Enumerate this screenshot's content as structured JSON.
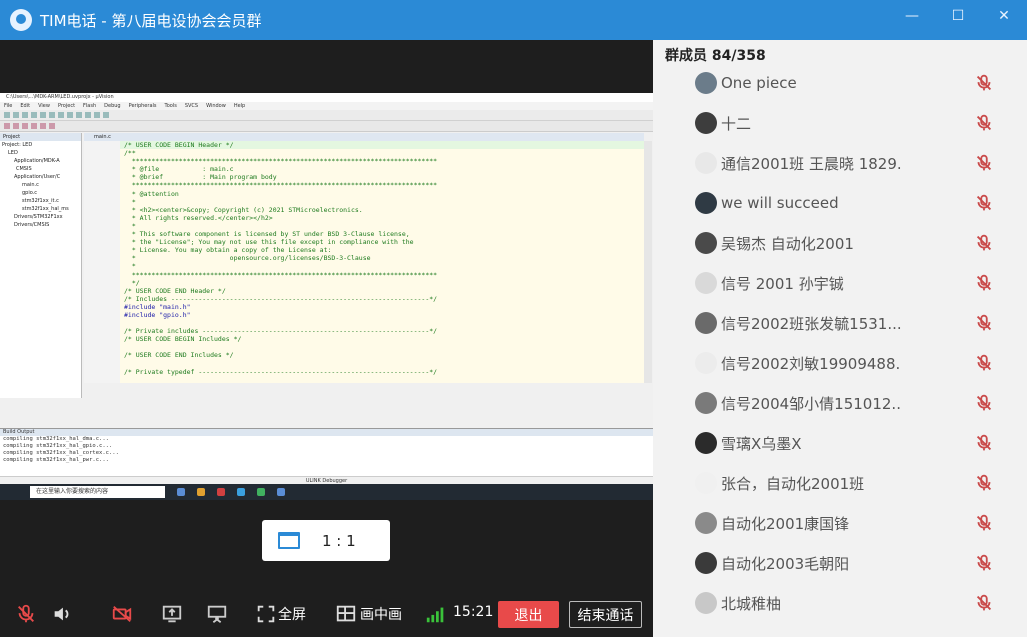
{
  "window": {
    "title": "TIM电话 - 第八届电设协会会员群",
    "controls": [
      "—",
      "☐",
      "✕"
    ]
  },
  "shared_screen": {
    "ide_title": "C:\\Users\\...\\MDK-ARM\\LED.uvprojx - µVision",
    "ide_menu": [
      "File",
      "Edit",
      "View",
      "Project",
      "Flash",
      "Debug",
      "Peripherals",
      "Tools",
      "SVCS",
      "Window",
      "Help"
    ],
    "project_header": "Project",
    "project_tree": [
      "Project: LED",
      "LED",
      "Application/MDK-A",
      "CMSIS",
      "Application/User/C",
      "main.c",
      "gpio.c",
      "stm32f1xx_it.c",
      "stm32f1xx_hal_ms",
      "Drivers/STM32F1xx",
      "Drivers/CMSIS"
    ],
    "editor_tab": "main.c",
    "code_lines": [
      "/* USER CODE BEGIN Header */",
      "/**",
      "  ******************************************************************************",
      "  * @file           : main.c",
      "  * @brief          : Main program body",
      "  ******************************************************************************",
      "  * @attention",
      "  *",
      "  * <h2><center>&copy; Copyright (c) 2021 STMicroelectronics.",
      "  * All rights reserved.</center></h2>",
      "  *",
      "  * This software component is licensed by ST under BSD 3-Clause license,",
      "  * the \"License\"; You may not use this file except in compliance with the",
      "  * License. You may obtain a copy of the License at:",
      "  *                        opensource.org/licenses/BSD-3-Clause",
      "  *",
      "  ******************************************************************************",
      "  */",
      "/* USER CODE END Header */",
      "/* Includes ------------------------------------------------------------------*/",
      "#include \"main.h\"",
      "#include \"gpio.h\"",
      "",
      "/* Private includes ----------------------------------------------------------*/",
      "/* USER CODE BEGIN Includes */",
      "",
      "/* USER CODE END Includes */",
      "",
      "/* Private typedef -----------------------------------------------------------*/"
    ],
    "build_header": "Build Output",
    "build_lines": [
      "compiling stm32f1xx_hal_dma.c...",
      "compiling stm32f1xx_hal_gpio.c...",
      "compiling stm32f1xx_hal_cortex.c...",
      "compiling stm32f1xx_hal_pwr.c..."
    ],
    "status_text": "ULINK Debugger",
    "taskbar_search": "在这里输入你要搜索的内容"
  },
  "ratio": {
    "label": "1 : 1"
  },
  "controls": {
    "fullscreen_label": "全屏",
    "pip_label": "画中画",
    "time": "15:21",
    "hangup_label": "退出",
    "end_call_label": "结束通话"
  },
  "members": {
    "heading": "群成员 84/358",
    "list": [
      {
        "name": "One piece",
        "avatar": "#6b7c8a"
      },
      {
        "name": "十二",
        "avatar": "#3d3d3d"
      },
      {
        "name": "通信2001班 王晨晓 1829...",
        "avatar": "#e8e8e8"
      },
      {
        "name": "we will succeed",
        "avatar": "#2f3a44"
      },
      {
        "name": "吴锡杰 自动化2001",
        "avatar": "#4a4a4a"
      },
      {
        "name": "信号 2001 孙宇铖",
        "avatar": "#d9d9d9"
      },
      {
        "name": "信号2002班张发毓1531...",
        "avatar": "#6a6a6a"
      },
      {
        "name": "信号2002刘敏19909488...",
        "avatar": "#ececec"
      },
      {
        "name": "信号2004邹小倩151012...",
        "avatar": "#7a7a7a"
      },
      {
        "name": "雪璃X乌墨X",
        "avatar": "#2b2b2b"
      },
      {
        "name": "张合，自动化2001班",
        "avatar": "#f0f0f0"
      },
      {
        "name": "自动化2001康国锋",
        "avatar": "#8a8a8a"
      },
      {
        "name": "自动化2003毛朝阳",
        "avatar": "#3a3a3a"
      },
      {
        "name": "北城稚柚",
        "avatar": "#c8c8c8"
      }
    ]
  },
  "colors": {
    "titlebar": "#2b8ad6",
    "mute_icon": "#c94a4a",
    "hangup": "#e84a4a"
  }
}
